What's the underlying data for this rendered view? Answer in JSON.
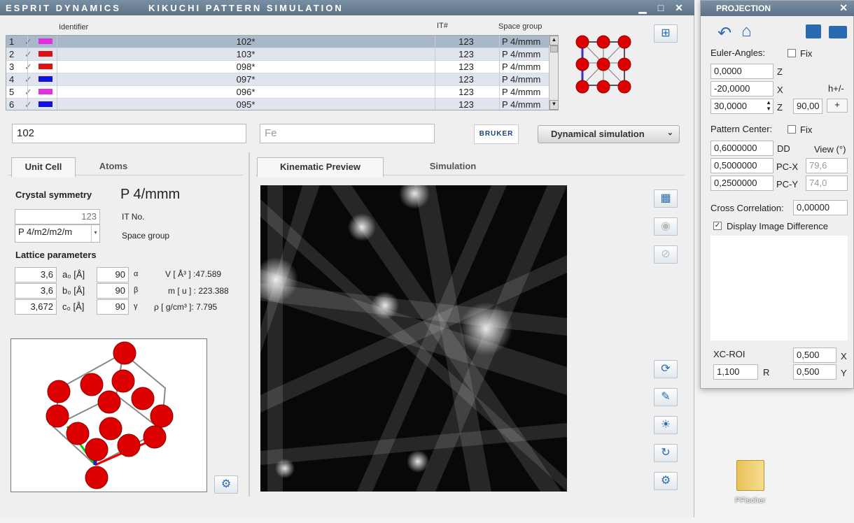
{
  "window": {
    "title1": "ESPRIT DYNAMICS",
    "title2": "KIKUCHI PATTERN SIMULATION",
    "min": "▁",
    "max": "□",
    "close": "✕"
  },
  "grid": {
    "headers": {
      "identifier": "Identifier",
      "it": "IT#",
      "space": "Space group"
    },
    "rows": [
      {
        "n": "1",
        "check": "✓",
        "color": "#e030e0",
        "id": "102*",
        "it": "123",
        "sg": "P 4/mmm"
      },
      {
        "n": "2",
        "check": "✓",
        "color": "#e01010",
        "id": "103*",
        "it": "123",
        "sg": "P 4/mmm"
      },
      {
        "n": "3",
        "check": "✓",
        "color": "#e01010",
        "id": "098*",
        "it": "123",
        "sg": "P 4/mmm"
      },
      {
        "n": "4",
        "check": "✓",
        "color": "#1010e0",
        "id": "097*",
        "it": "123",
        "sg": "P 4/mmm"
      },
      {
        "n": "5",
        "check": "✓",
        "color": "#e030e0",
        "id": "096*",
        "it": "123",
        "sg": "P 4/mmm"
      },
      {
        "n": "6",
        "check": "✓",
        "color": "#1010e0",
        "id": "095*",
        "it": "123",
        "sg": "P 4/mmm"
      }
    ]
  },
  "fields": {
    "identifier": "102",
    "element_placeholder": "Fe"
  },
  "logo": "BRUKER",
  "dyn_button": "Dynamical simulation",
  "left_tabs": {
    "unit_cell": "Unit Cell",
    "atoms": "Atoms"
  },
  "crystal": {
    "sym_label": "Crystal symmetry",
    "sym_value": "P 4/mmm",
    "it_value": "123",
    "it_label": "IT No.",
    "space_value": "P 4/m2/m2/m",
    "space_label": "Space group",
    "lattice_label": "Lattice parameters",
    "a": "3,6",
    "a_lbl": "a₀ [Å]",
    "alpha": "90",
    "alpha_lbl": "α",
    "b": "3,6",
    "b_lbl": "b₀ [Å]",
    "beta": "90",
    "beta_lbl": "β",
    "c": "3,672",
    "c_lbl": "c₀ [Å]",
    "gamma": "90",
    "gamma_lbl": "γ",
    "v": "V [ Å³ ] :47.589",
    "m": "m [ u ] : 223.388",
    "rho": "ρ [ g/cm³ ]: 7.795"
  },
  "right_tabs": {
    "kin": "Kinematic Preview",
    "sim": "Simulation"
  },
  "projection": {
    "title": "PROJECTION",
    "euler_label": "Euler-Angles:",
    "fix": "Fix",
    "z1": "0,0000",
    "z1_lbl": "Z",
    "x": "-20,0000",
    "x_lbl": "X",
    "hpm": "h+/-",
    "z2": "30,0000",
    "z2_lbl": "Z",
    "step": "90,00",
    "plus": "+",
    "pc_label": "Pattern Center:",
    "dd": "0,6000000",
    "dd_lbl": "DD",
    "view_lbl": "View (°)",
    "pcx": "0,5000000",
    "pcx_lbl": "PC-X",
    "pcx_view": "79,6",
    "pcy": "0,2500000",
    "pcy_lbl": "PC-Y",
    "pcy_view": "74,0",
    "cc_label": "Cross Correlation:",
    "cc": "0,00000",
    "diff_label": "Display Image Difference",
    "xc_label": "XC-ROI",
    "xc_x": "0,500",
    "xc_x_lbl": "X",
    "r": "1,100",
    "r_lbl": "R",
    "xc_y": "0,500",
    "xc_y_lbl": "Y"
  },
  "desktop": {
    "folder": "PFischer"
  }
}
